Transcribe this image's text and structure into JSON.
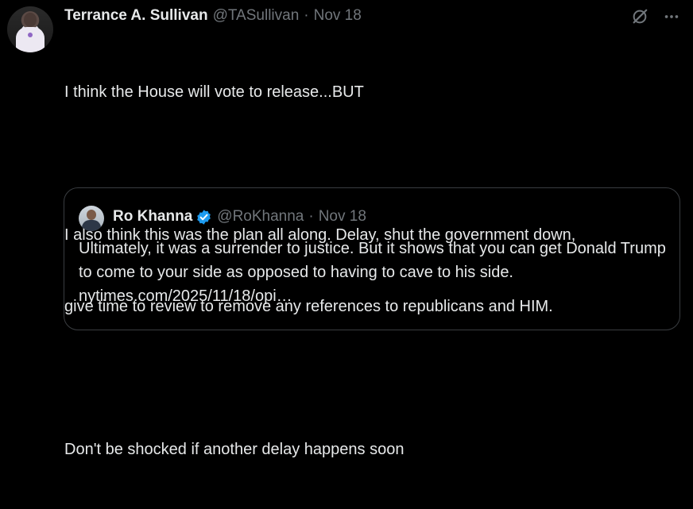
{
  "tweet": {
    "display_name": "Terrance A. Sullivan",
    "handle": "@TASullivan",
    "separator": "·",
    "date": "Nov 18",
    "text_lines": [
      "I think the House will vote to release...BUT",
      "",
      "I also think this was the plan all along. Delay, shut the government down,",
      "give time to review to remove any references to republicans and HIM.",
      "",
      "Don't be shocked if another delay happens soon"
    ],
    "icons": [
      "grok-icon",
      "more-icon"
    ]
  },
  "quote": {
    "display_name": "Ro Khanna",
    "handle": "@RoKhanna",
    "separator": "·",
    "date": "Nov 18",
    "verified_color": "#1d9bf0",
    "text": "Ultimately, it was a surrender to justice. But it shows that you can get Donald Trump to come to your side as opposed to having to cave to his side. nytimes.com/2025/11/18/opi…"
  },
  "colors": {
    "background": "#000000",
    "primary_text": "#e7e9ea",
    "secondary_text": "#71767b",
    "border": "#3a3d41"
  }
}
